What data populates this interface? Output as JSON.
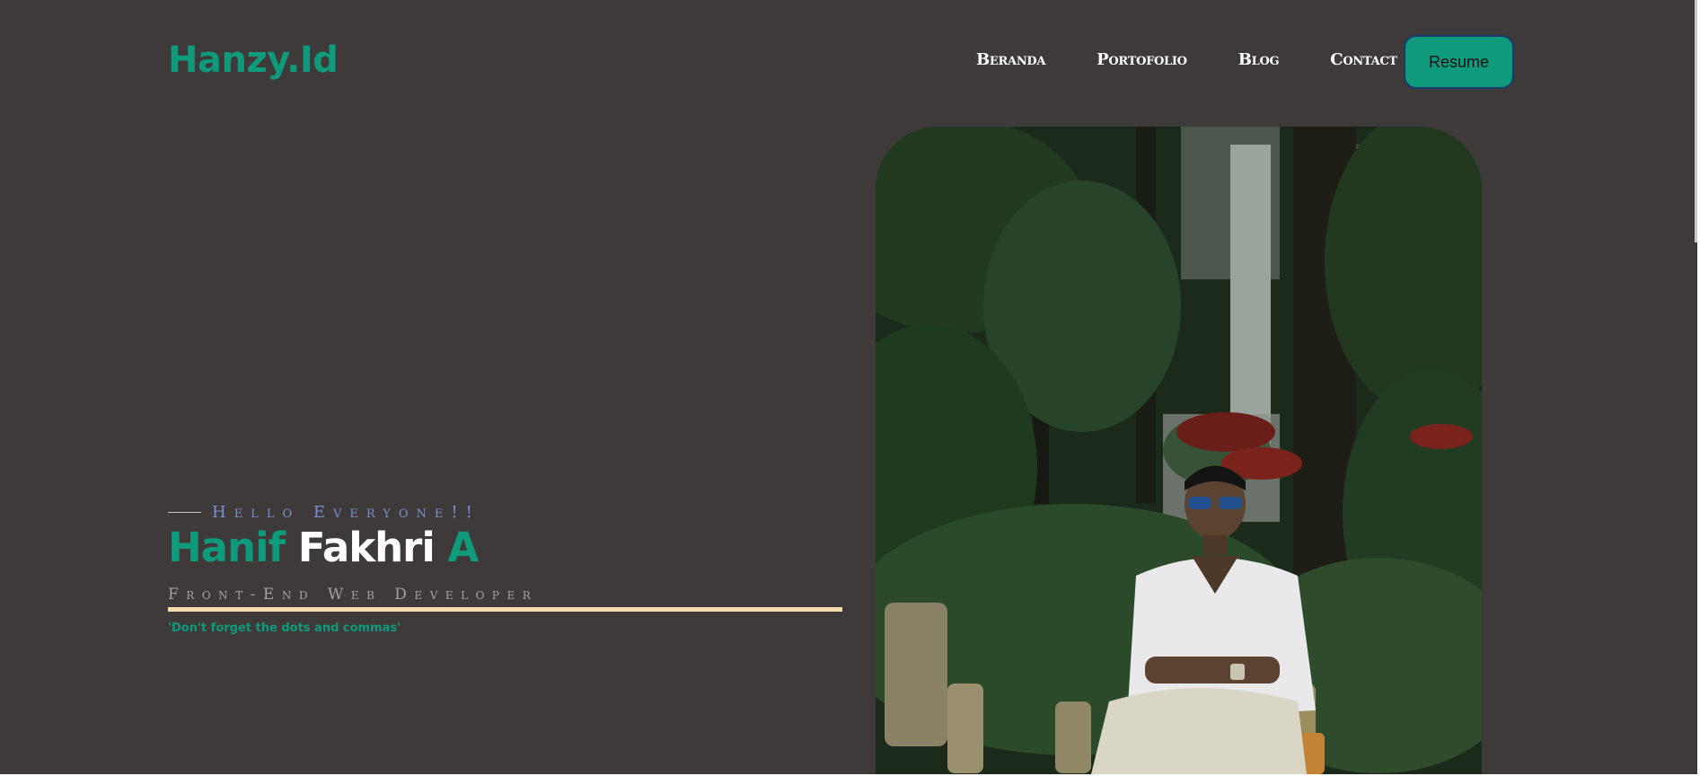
{
  "header": {
    "logo": "Hanzy.Id",
    "nav": [
      "Beranda",
      "Portofolio",
      "Blog",
      "Contact"
    ],
    "resume_label": "Resume"
  },
  "hero": {
    "greeting": "Hello Everyone!!",
    "name_first": "Hanif",
    "name_middle": "Fakhri",
    "name_last": "A",
    "role": "Front-End Web Developer",
    "quote": "'Don't forget the dots and commas'"
  },
  "colors": {
    "background": "#3e3a3a",
    "accent": "#0f9a7c",
    "underline": "#f7dcae",
    "greeting": "#7b8fd0"
  }
}
